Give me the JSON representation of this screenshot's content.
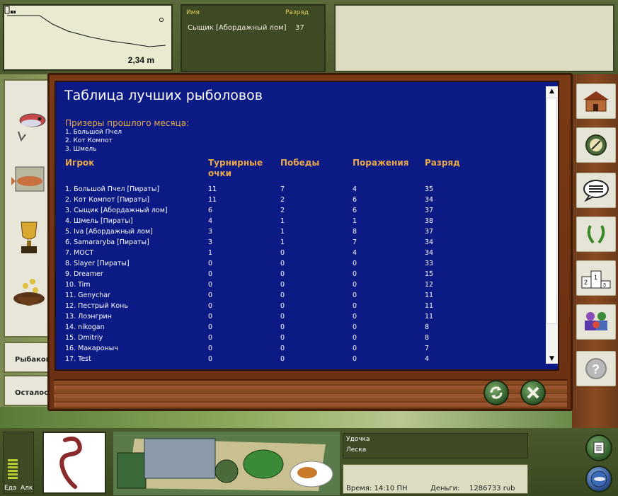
{
  "depth": {
    "value": "2,34 m"
  },
  "crew": {
    "headers": {
      "name": "Имя",
      "rank": "Разряд"
    },
    "row": {
      "name": "Сыщик [Абордажный лом]",
      "rank": "37"
    }
  },
  "left_panel": {
    "labels": [
      "Рыбаков",
      "Осталось"
    ]
  },
  "leaderboard": {
    "title": "Таблица лучших рыболовов",
    "prize_title": "Призеры прошлого месяца:",
    "prizes": [
      "1. Большой Пчел",
      "2. Кот Компот",
      "3. Шмель"
    ],
    "columns": {
      "player": "Игрок",
      "points_line1": "Турнирные",
      "points_line2": "очки",
      "wins": "Победы",
      "losses": "Поражения",
      "rank": "Разряд"
    },
    "rows": [
      {
        "player": "1. Большой Пчел [Пираты]",
        "points": "11",
        "wins": "7",
        "losses": "4",
        "rank": "35"
      },
      {
        "player": "2. Кот Компот [Пираты]",
        "points": "11",
        "wins": "2",
        "losses": "6",
        "rank": "34"
      },
      {
        "player": "3. Сыщик [Абордажный лом]",
        "points": "6",
        "wins": "2",
        "losses": "6",
        "rank": "37"
      },
      {
        "player": "4. Шмель [Пираты]",
        "points": "4",
        "wins": "1",
        "losses": "1",
        "rank": "38"
      },
      {
        "player": "5. Iva [Абордажный лом]",
        "points": "3",
        "wins": "1",
        "losses": "8",
        "rank": "37"
      },
      {
        "player": "6. Samararyba [Пираты]",
        "points": "3",
        "wins": "1",
        "losses": "7",
        "rank": "34"
      },
      {
        "player": "7. МОСТ",
        "points": "1",
        "wins": "0",
        "losses": "4",
        "rank": "34"
      },
      {
        "player": "8. Slayer [Пираты]",
        "points": "0",
        "wins": "0",
        "losses": "0",
        "rank": "33"
      },
      {
        "player": "9. Dreamer",
        "points": "0",
        "wins": "0",
        "losses": "0",
        "rank": "15"
      },
      {
        "player": "10. Tim",
        "points": "0",
        "wins": "0",
        "losses": "0",
        "rank": "12"
      },
      {
        "player": "11. Genychar",
        "points": "0",
        "wins": "0",
        "losses": "0",
        "rank": "11"
      },
      {
        "player": "12. Пестрый Конь",
        "points": "0",
        "wins": "0",
        "losses": "0",
        "rank": "11"
      },
      {
        "player": "13. Лоэнгрин",
        "points": "0",
        "wins": "0",
        "losses": "0",
        "rank": "11"
      },
      {
        "player": "14. nikogan",
        "points": "0",
        "wins": "0",
        "losses": "0",
        "rank": "8"
      },
      {
        "player": "15. Dmitriy",
        "points": "0",
        "wins": "0",
        "losses": "0",
        "rank": "8"
      },
      {
        "player": "16. Макароныч",
        "points": "0",
        "wins": "0",
        "losses": "0",
        "rank": "7"
      },
      {
        "player": "17. Test",
        "points": "0",
        "wins": "0",
        "losses": "0",
        "rank": "4"
      }
    ]
  },
  "bottom": {
    "meters": {
      "food": "Еда",
      "alcohol": "Алк"
    },
    "gear": {
      "rod": "Удочка",
      "line": "Леска"
    },
    "status": {
      "time": "Время: 14:10 ПН",
      "money_label": "Деньги:",
      "money_value": "1286733 rub"
    }
  },
  "icons": {
    "right_side": [
      "house-icon",
      "compass-icon",
      "chat-icon",
      "laurel-icon",
      "podium-icon",
      "people-icon",
      "help-icon"
    ],
    "board_buttons": [
      "refresh-icon",
      "close-icon"
    ]
  },
  "colors": {
    "board_bg": "#0c1a85",
    "header_orange": "#e8a848",
    "wood": "#7a3a16"
  }
}
